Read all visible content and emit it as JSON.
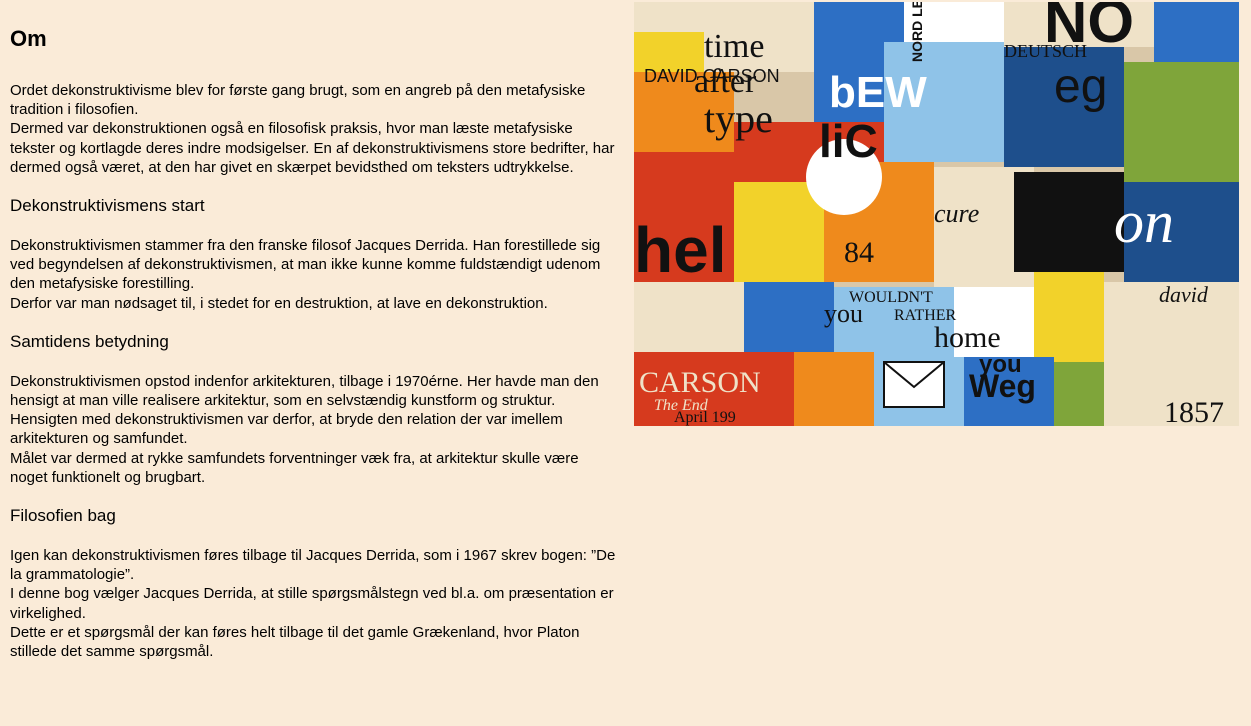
{
  "title": "Om",
  "intro": "Ordet dekonstruktivisme blev for første gang brugt, som en angreb på den metafysiske tradition i filosofien.\nDermed var dekonstruktionen også en filosofisk praksis, hvor man læste metafysiske tekster og kortlagde deres indre modsigelser. En af dekonstruktivismens store bedrifter, har dermed også været, at den har givet en skærpet bevidsthed om teksters udtrykkelse.",
  "sections": [
    {
      "heading": "Dekonstruktivismens start",
      "text": "Dekonstruktivismen stammer fra den franske filosof Jacques Derrida. Han forestillede sig ved begyndelsen af dekonstruktivismen, at man ikke kunne komme fuldstændigt udenom den metafysiske forestilling.\nDerfor var man nødsaget til, i stedet for en destruktion, at lave en dekonstruktion."
    },
    {
      "heading": "Samtidens betydning",
      "text": "Dekonstruktivismen opstod indenfor arkitekturen, tilbage i 1970érne. Her havde man den hensigt at man ville realisere arkitektur, som en selvstændig kunstform og struktur.\nHensigten med dekonstruktivismen var derfor, at bryde den relation der var imellem arkitekturen og samfundet.\nMålet var dermed at rykke samfundets forventninger væk fra, at arkitektur skulle være noget funktionelt og brugbart."
    },
    {
      "heading": "Filosofien bag",
      "text": "Igen kan dekonstruktivismen føres tilbage til Jacques Derrida, som i 1967 skrev bogen: ”De la grammatologie”.\nI denne bog vælger Jacques Derrida, at stille spørgsmålstegn ved bl.a. om præsentation er virkelighed.\nDette er et spørgsmål der kan føres helt tilbage til det gamle Grækenland, hvor Platon stillede det samme spørgsmål."
    }
  ],
  "collage": {
    "words": [
      "time",
      "after",
      "type",
      "bEW",
      "eg",
      "liC",
      "DAVID CARSON",
      "hel",
      "cure",
      "WOULDN'T",
      "you",
      "RATHER",
      "home",
      "you",
      "Weg",
      "CARSON",
      "The End",
      "April 199",
      "1857",
      "david",
      "NORD LB",
      "DEUTSCH",
      "84",
      "on",
      "NO"
    ],
    "colors": {
      "background": "#faebd8",
      "red": "#d63a1e",
      "orange": "#ef8a1c",
      "yellow": "#f2d22a",
      "blue": "#2d6fc4",
      "lightblue": "#8fc3e8",
      "green": "#7fa53a",
      "black": "#111111",
      "cream": "#efe2c8"
    }
  }
}
